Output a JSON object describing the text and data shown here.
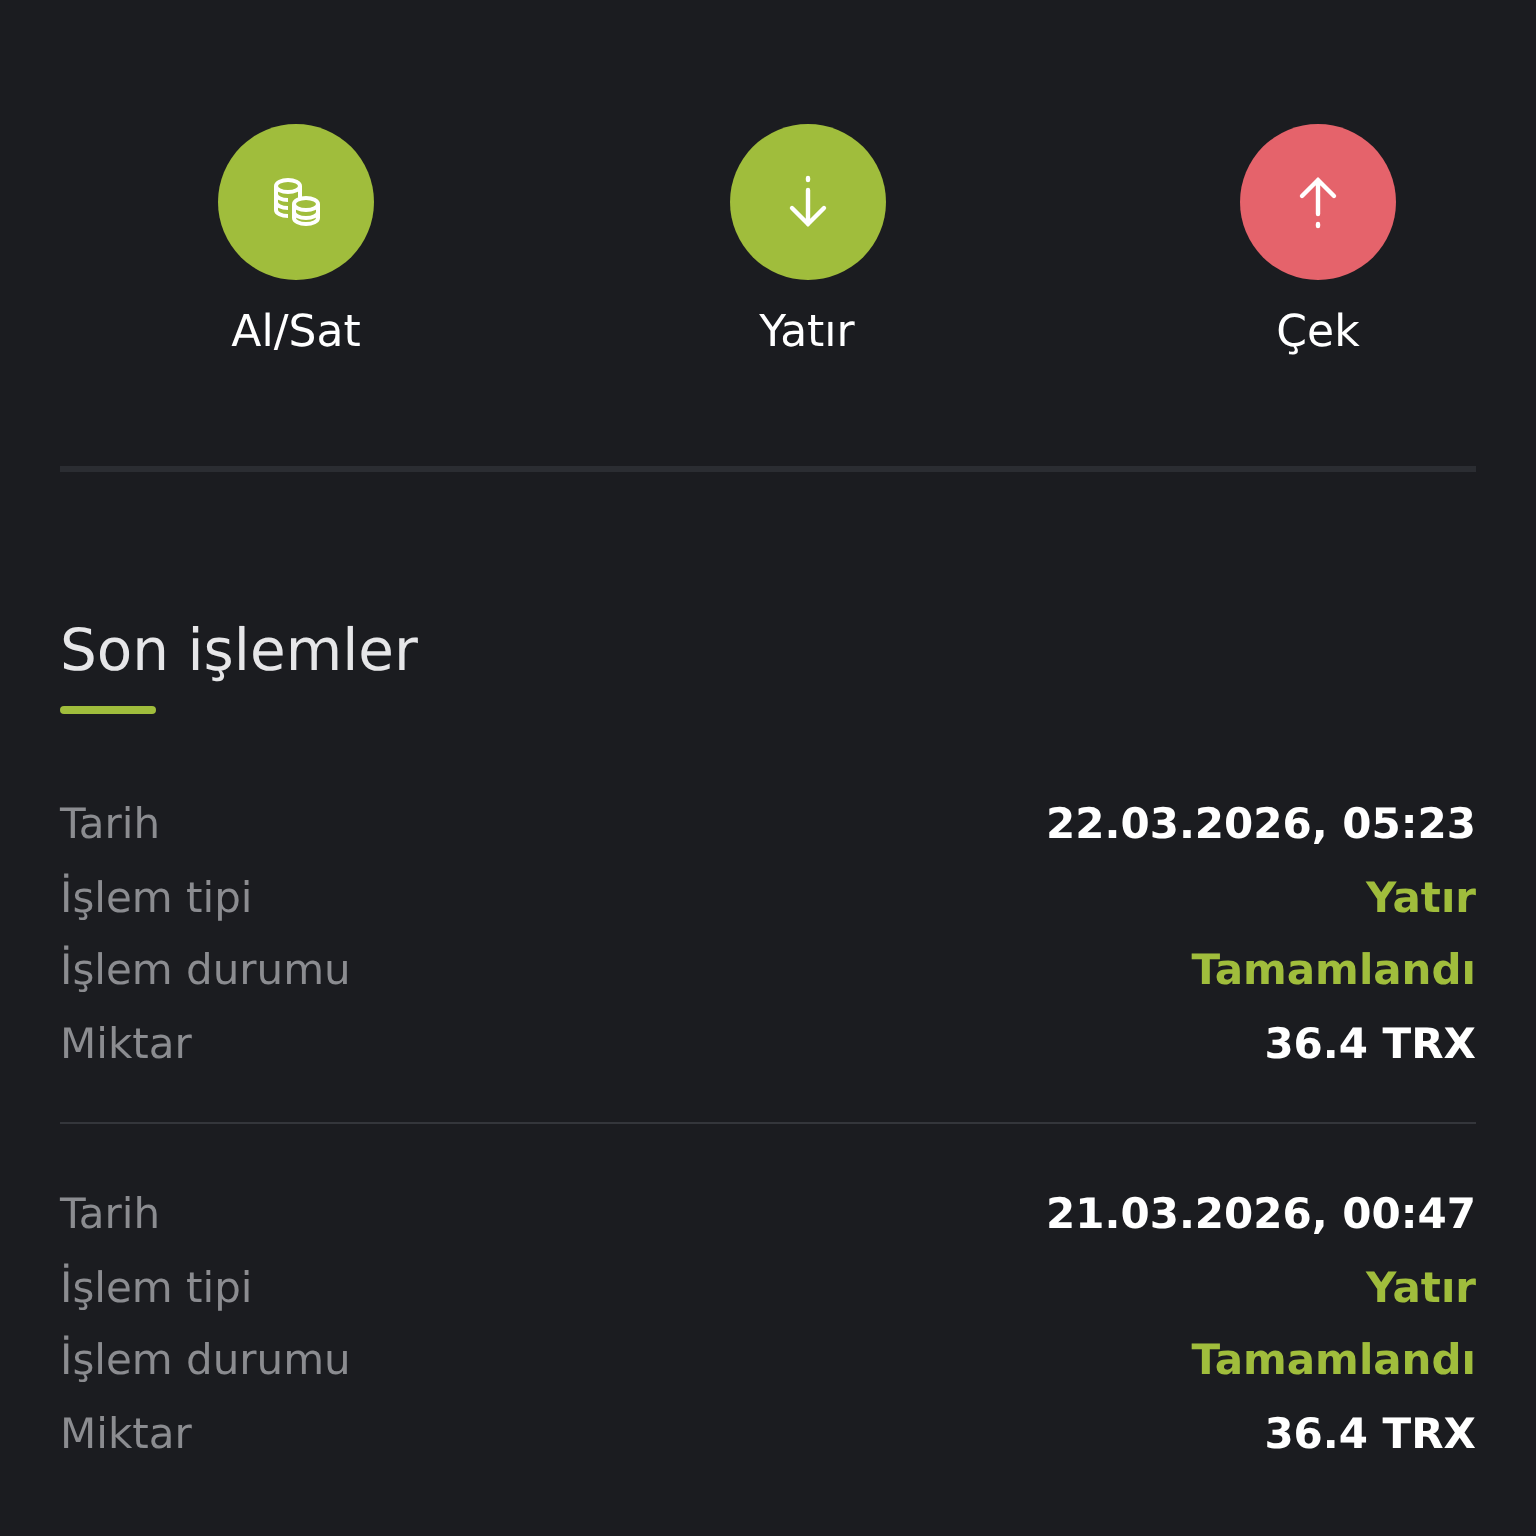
{
  "actions": [
    {
      "label": "Al/Sat",
      "kind": "coins",
      "color": "#a0bd3c"
    },
    {
      "label": "Yatır",
      "kind": "down",
      "color": "#a0bd3c"
    },
    {
      "label": "Çek",
      "kind": "up",
      "color": "#e5636b"
    }
  ],
  "section": {
    "title": "Son işlemler"
  },
  "transactions": [
    {
      "fields": [
        {
          "label": "Tarih",
          "value": "22.03.2026, 05:23",
          "kind": "plain"
        },
        {
          "label": "İşlem tipi",
          "value": "Yatır",
          "kind": "accent"
        },
        {
          "label": "İşlem durumu",
          "value": "Tamamlandı",
          "kind": "accent"
        },
        {
          "label": "Miktar",
          "value": "36.4 TRX",
          "kind": "plain"
        }
      ]
    },
    {
      "fields": [
        {
          "label": "Tarih",
          "value": "21.03.2026, 00:47",
          "kind": "plain"
        },
        {
          "label": "İşlem tipi",
          "value": "Yatır",
          "kind": "accent"
        },
        {
          "label": "İşlem durumu",
          "value": "Tamamlandı",
          "kind": "accent"
        },
        {
          "label": "Miktar",
          "value": "36.4 TRX",
          "kind": "plain"
        }
      ]
    }
  ]
}
